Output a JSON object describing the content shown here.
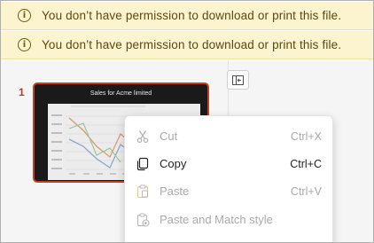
{
  "banners": [
    {
      "icon": "info-icon",
      "text": "You don’t have permission to download or print this file."
    },
    {
      "icon": "info-icon",
      "text": "You don’t have permission to download or print this file."
    }
  ],
  "slide": {
    "number": "1",
    "title": "Sales for Acme limited"
  },
  "context_menu": {
    "items": [
      {
        "label": "Cut",
        "shortcut": "Ctrl+X",
        "icon": "scissors-icon",
        "enabled": false
      },
      {
        "label": "Copy",
        "shortcut": "Ctrl+C",
        "icon": "copy-icon",
        "enabled": true
      },
      {
        "label": "Paste",
        "shortcut": "Ctrl+V",
        "icon": "clipboard-icon",
        "enabled": false
      },
      {
        "label": "Paste and Match style",
        "shortcut": "",
        "icon": "paste-match-icon",
        "enabled": false
      }
    ]
  },
  "colors": {
    "banner_bg": "#fbf4cf",
    "slide_border": "#c43d24",
    "slide_number": "#c0392b"
  }
}
